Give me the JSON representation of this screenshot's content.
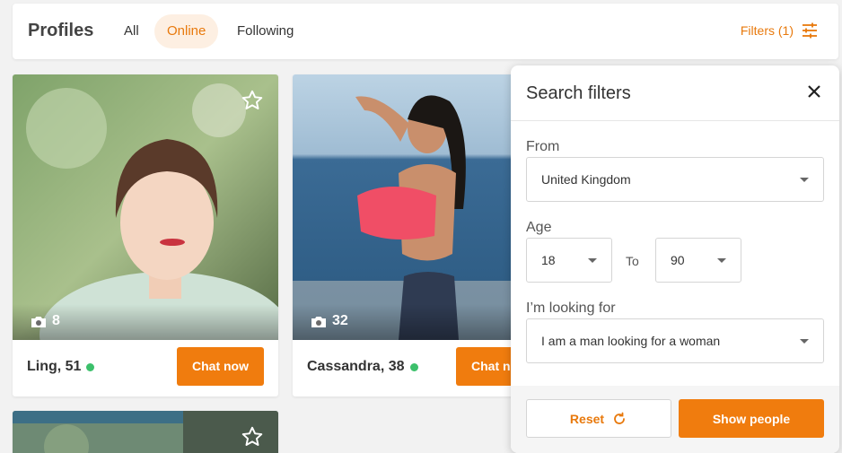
{
  "header": {
    "title": "Profiles",
    "tabs": [
      {
        "label": "All",
        "active": false
      },
      {
        "label": "Online",
        "active": true
      },
      {
        "label": "Following",
        "active": false
      }
    ],
    "filters_label": "Filters (1)",
    "filters_icon": "sliders-icon"
  },
  "colors": {
    "accent": "#f07c0e",
    "accent_text": "#e8790c",
    "online": "#3cc06b",
    "active_tab_bg": "#fdefe2"
  },
  "profiles": [
    {
      "name": "Ling, 51",
      "photo_count": "8",
      "chat_label": "Chat now",
      "online": true
    },
    {
      "name": "Cassandra, 38",
      "photo_count": "32",
      "chat_label": "Chat now",
      "online": true
    }
  ],
  "filters_panel": {
    "title": "Search filters",
    "from_label": "From",
    "from_value": "United Kingdom",
    "age_label": "Age",
    "age_from": "18",
    "age_to_label": "To",
    "age_to": "90",
    "looking_label": "I’m looking for",
    "looking_value": "I am a man looking for a woman",
    "reset_label": "Reset",
    "show_label": "Show people"
  }
}
